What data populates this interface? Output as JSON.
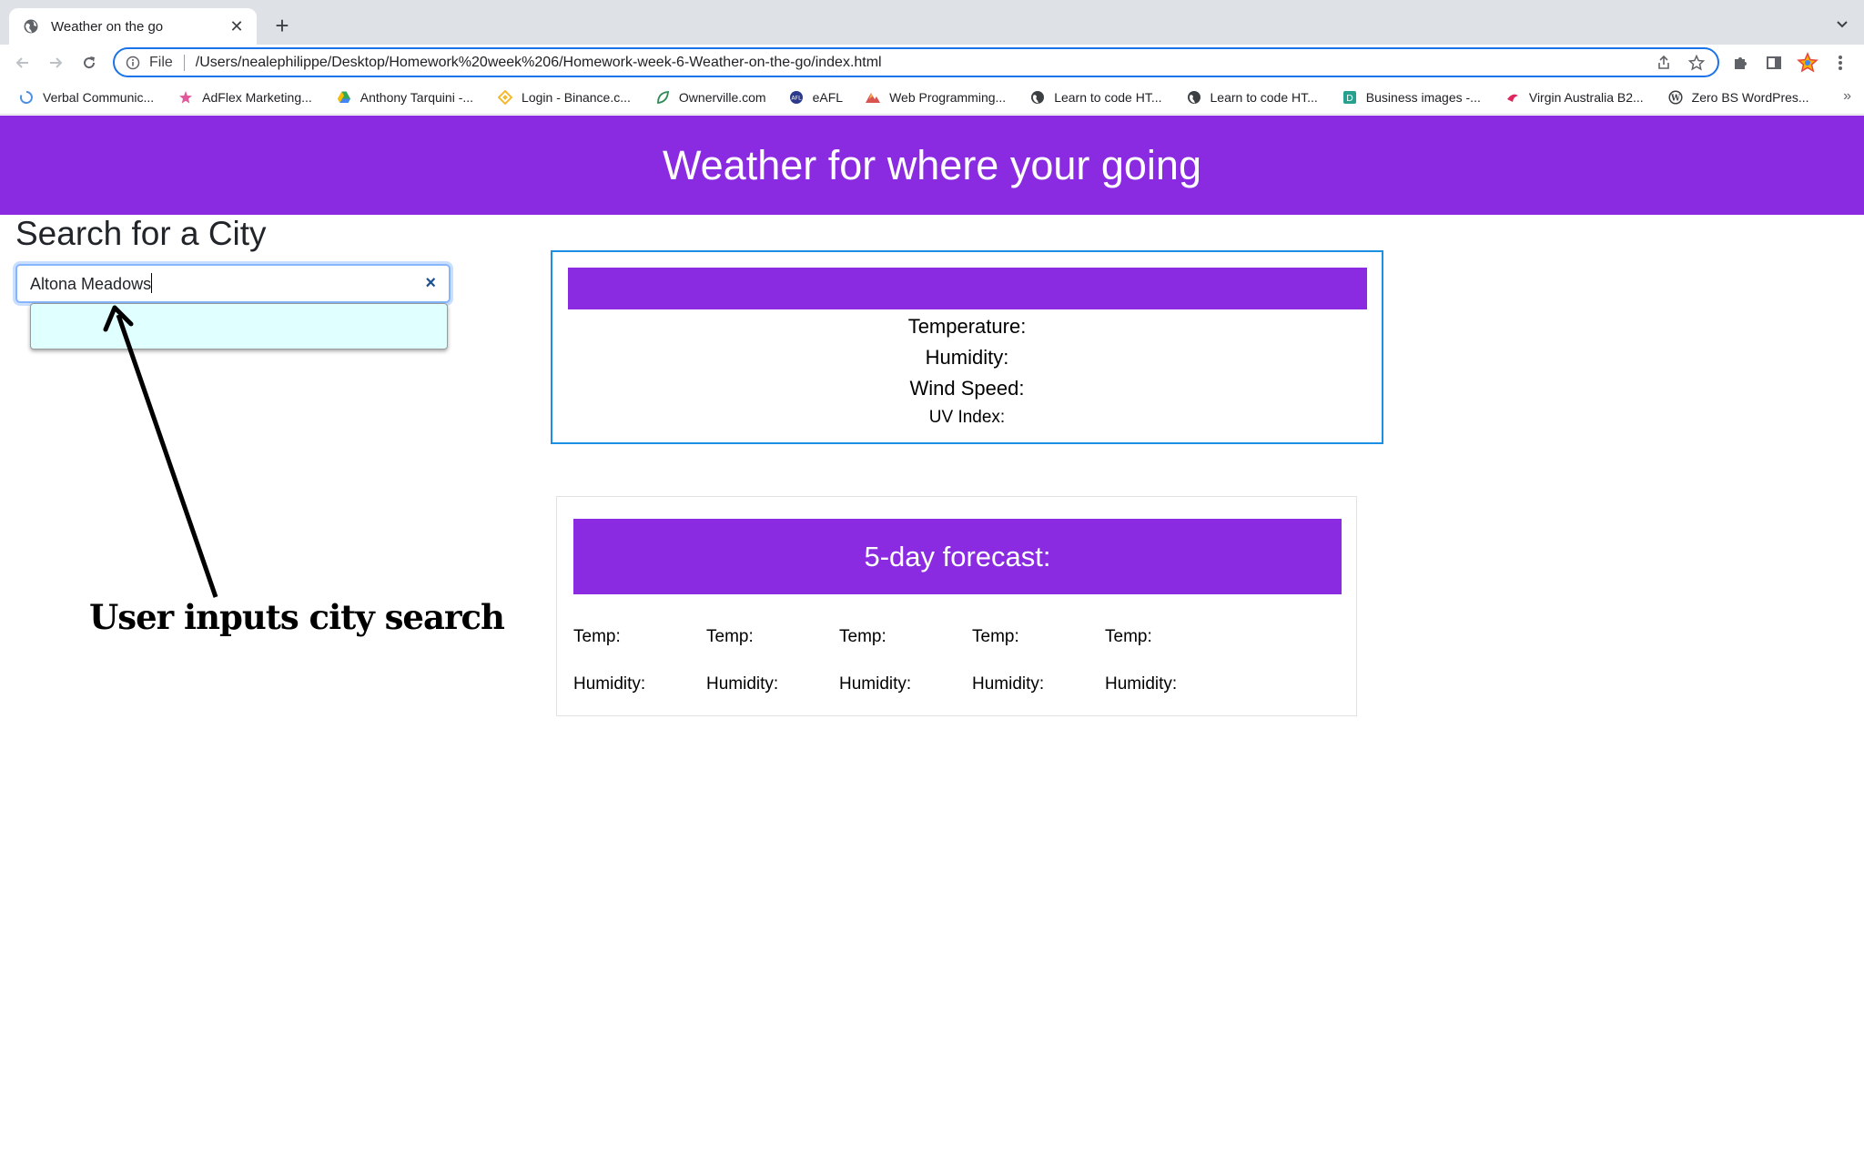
{
  "browser": {
    "tab_title": "Weather on the go",
    "new_tab": "+",
    "address_scheme": "File",
    "address_url": "/Users/nealephilippe/Desktop/Homework%20week%206/Homework-week-6-Weather-on-the-go/index.html",
    "bookmarks": [
      {
        "label": "Verbal Communic...",
        "icon": "loading-circle-icon",
        "color": "#4a90e2"
      },
      {
        "label": "AdFlex Marketing...",
        "icon": "star-badge-icon",
        "color": "#e0589a"
      },
      {
        "label": "Anthony Tarquini -...",
        "icon": "google-drive-icon",
        "color": "#34a853"
      },
      {
        "label": "Login - Binance.c...",
        "icon": "binance-icon",
        "color": "#f3ba2f"
      },
      {
        "label": "Ownerville.com",
        "icon": "leaf-icon",
        "color": "#2e8b57"
      },
      {
        "label": "eAFL",
        "icon": "afl-icon",
        "color": "#2b3a8c"
      },
      {
        "label": "Web Programming...",
        "icon": "mountain-icon",
        "color": "#d9534f"
      },
      {
        "label": "Learn to code HT...",
        "icon": "globe-icon",
        "color": "#3c4043"
      },
      {
        "label": "Learn to code HT...",
        "icon": "globe-icon",
        "color": "#3c4043"
      },
      {
        "label": "Business images -...",
        "icon": "d-square-icon",
        "color": "#25a18e"
      },
      {
        "label": "Virgin Australia B2...",
        "icon": "virgin-icon",
        "color": "#e0245e"
      },
      {
        "label": "Zero BS WordPres...",
        "icon": "wordpress-icon",
        "color": "#3c4043"
      }
    ],
    "bookmarks_more": "»"
  },
  "page": {
    "header_title": "Weather for where your going",
    "search_title": "Search for a City",
    "search_value": "Altona Meadows",
    "clear_glyph": "×"
  },
  "annotation": {
    "text": "User inputs city search"
  },
  "current_weather": {
    "temperature": "Temperature:",
    "humidity": "Humidity:",
    "wind": "Wind Speed:",
    "uv": "UV Index:"
  },
  "forecast": {
    "title": "5-day forecast:",
    "days": [
      {
        "temp": "Temp:",
        "humidity": "Humidity:"
      },
      {
        "temp": "Temp:",
        "humidity": "Humidity:"
      },
      {
        "temp": "Temp:",
        "humidity": "Humidity:"
      },
      {
        "temp": "Temp:",
        "humidity": "Humidity:"
      },
      {
        "temp": "Temp:",
        "humidity": "Humidity:"
      }
    ]
  },
  "colors": {
    "accent_purple": "#8a2be2",
    "focus_blue": "#1a73e8",
    "suggest_bg": "#e0ffff"
  }
}
